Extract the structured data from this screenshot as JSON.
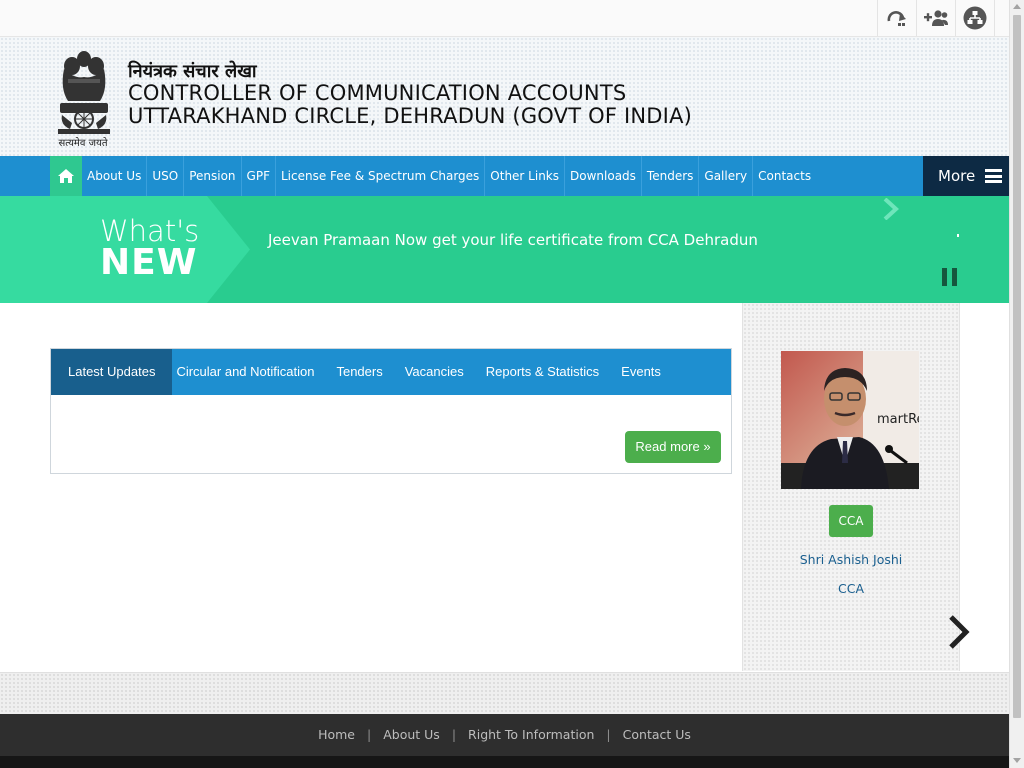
{
  "topbar": {
    "icons": [
      "skip-to-content-icon",
      "add-user-icon",
      "sitemap-icon"
    ]
  },
  "header": {
    "hindi_title": "नियंत्रक संचार लेखा",
    "title_line1": "CONTROLLER OF COMMUNICATION ACCOUNTS",
    "title_line2": "UTTARAKHAND CIRCLE, DEHRADUN (GOVT OF INDIA)",
    "emblem_caption": "सत्यमेव जयते"
  },
  "nav": {
    "items": [
      {
        "label": "About Us"
      },
      {
        "label": "USO"
      },
      {
        "label": "Pension"
      },
      {
        "label": "GPF"
      },
      {
        "label": "License Fee & Spectrum Charges"
      },
      {
        "label": "Other Links"
      },
      {
        "label": "Downloads"
      },
      {
        "label": "Tenders"
      },
      {
        "label": "Gallery"
      },
      {
        "label": "Contacts"
      }
    ],
    "more_label": "More"
  },
  "whats_new": {
    "whats": "What's",
    "new": "NEW",
    "ticker_text": "Jeevan Pramaan Now get your life certificate from CCA Dehradun"
  },
  "tabs": {
    "items": [
      {
        "label": "Latest Updates",
        "active": true
      },
      {
        "label": "Circular and Notification"
      },
      {
        "label": "Tenders"
      },
      {
        "label": "Vacancies"
      },
      {
        "label": "Reports & Statistics"
      },
      {
        "label": "Events"
      }
    ],
    "read_more": "Read more »"
  },
  "profile": {
    "badge": "CCA",
    "name": "Shri Ashish Joshi",
    "designation": "CCA",
    "photo_banner_text": "martRep"
  },
  "footer": {
    "links": [
      {
        "label": "Home"
      },
      {
        "label": "About Us"
      },
      {
        "label": "Right To Information"
      },
      {
        "label": "Contact Us"
      }
    ],
    "separator": "|"
  },
  "colors": {
    "nav_blue": "#1e8fd0",
    "green": "#29cc8f",
    "dark_navy": "#0d2a44",
    "button_green": "#4cae4c"
  }
}
